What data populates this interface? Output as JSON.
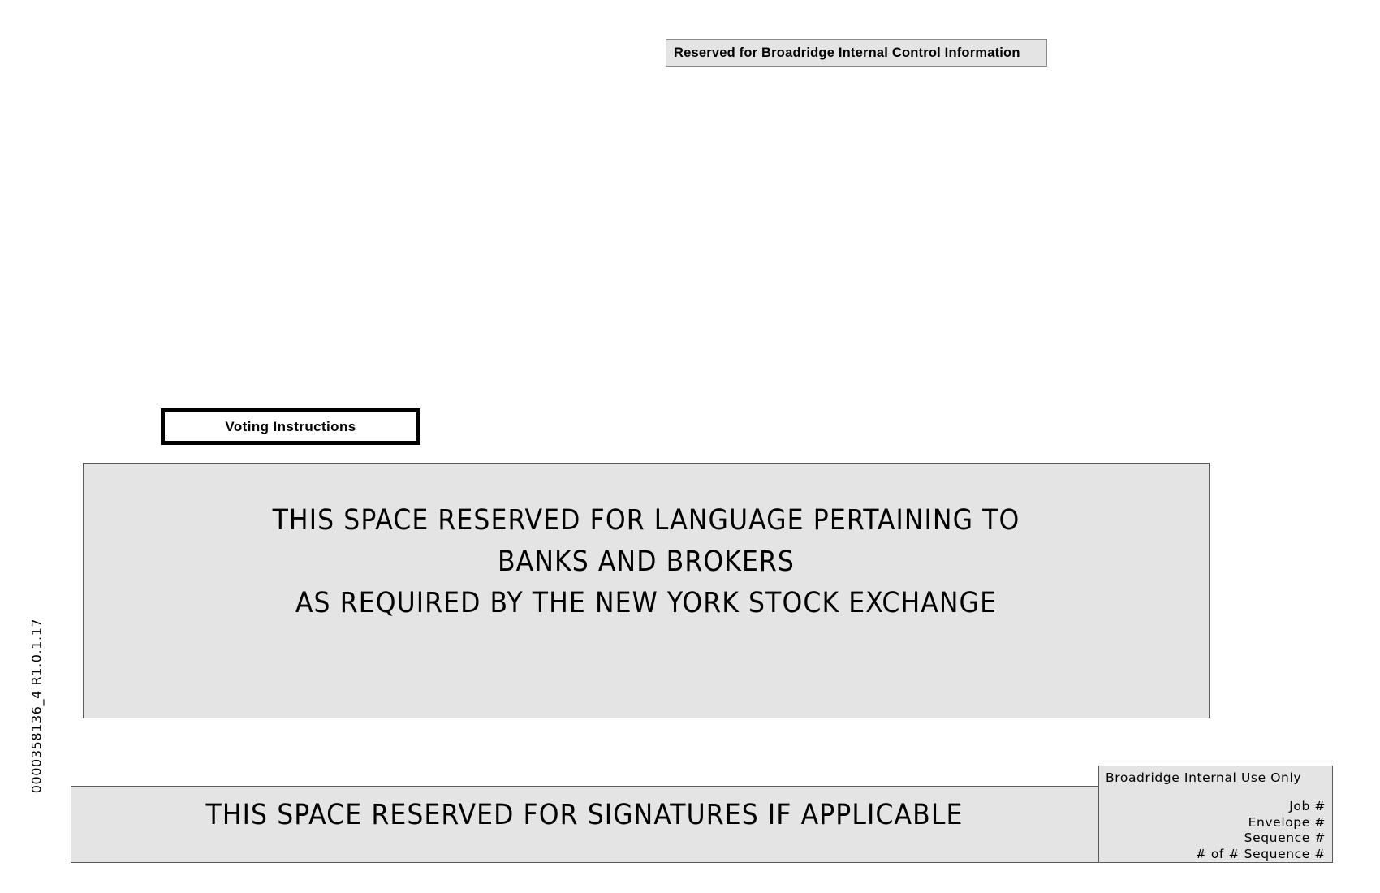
{
  "document": {
    "control_banner": {
      "label": "Reserved for Broadridge Internal Control Information"
    },
    "voting_tab": {
      "label": "Voting Instructions"
    },
    "main_panel": {
      "line1": "THIS SPACE RESERVED FOR LANGUAGE PERTAINING TO",
      "line2": "BANKS AND BROKERS",
      "line3": "AS REQUIRED BY THE NEW YORK STOCK EXCHANGE"
    },
    "signature_band": {
      "label": "THIS SPACE RESERVED FOR SIGNATURES IF APPLICABLE"
    },
    "internal_box": {
      "title": "Broadridge Internal Use Only",
      "fields": [
        "Job #",
        "Envelope #",
        "Sequence #",
        "# of # Sequence #"
      ]
    },
    "job_id": {
      "text": "0000358136_4    R1.0.1.17"
    },
    "colors": {
      "panel_fill": "#e4e4e4",
      "panel_border": "#5a5a5a",
      "tab_border": "#000000",
      "text": "#000000",
      "page_background": "#ffffff"
    }
  }
}
